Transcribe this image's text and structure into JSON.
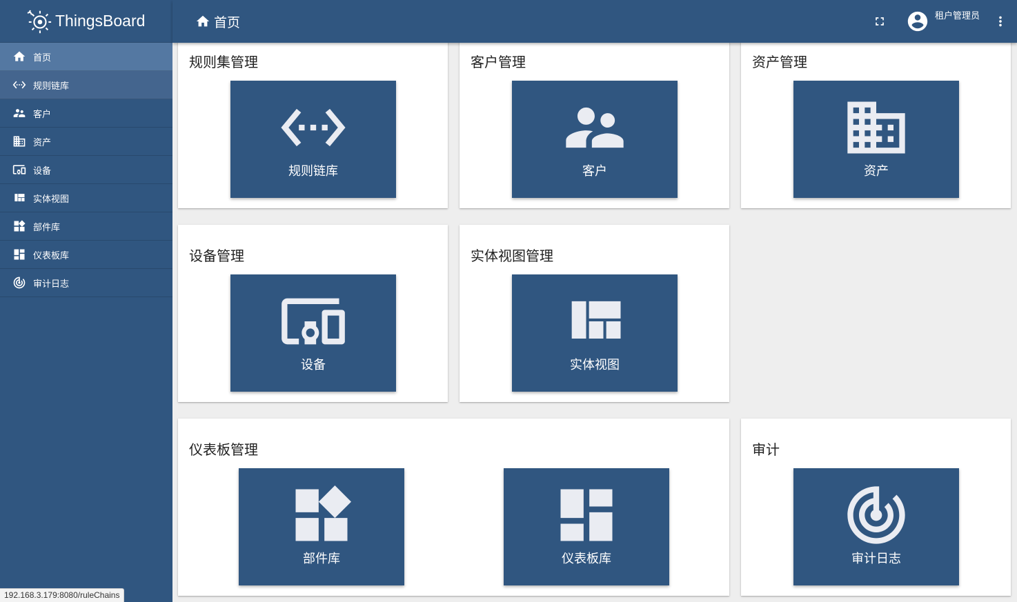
{
  "app": {
    "name": "ThingsBoard"
  },
  "header": {
    "breadcrumb": "首页",
    "user_role": "租户管理员"
  },
  "sidebar": {
    "items": [
      {
        "label": "首页",
        "icon": "home-icon"
      },
      {
        "label": "规则链库",
        "icon": "settings-ethernet-icon"
      },
      {
        "label": "客户",
        "icon": "supervisor-account-icon"
      },
      {
        "label": "资产",
        "icon": "domain-icon"
      },
      {
        "label": "设备",
        "icon": "devices-other-icon"
      },
      {
        "label": "实体视图",
        "icon": "view-quilt-icon"
      },
      {
        "label": "部件库",
        "icon": "widgets-icon"
      },
      {
        "label": "仪表板库",
        "icon": "dashboards-icon"
      },
      {
        "label": "审计日志",
        "icon": "track-changes-icon"
      }
    ]
  },
  "cards": {
    "rule": {
      "title": "规则集管理",
      "tile": "规则链库"
    },
    "customer": {
      "title": "客户管理",
      "tile": "客户"
    },
    "asset": {
      "title": "资产管理",
      "tile": "资产"
    },
    "device": {
      "title": "设备管理",
      "tile": "设备"
    },
    "entity_view": {
      "title": "实体视图管理",
      "tile": "实体视图"
    },
    "dashboard": {
      "title": "仪表板管理",
      "tile_widgets": "部件库",
      "tile_dashboards": "仪表板库"
    },
    "audit": {
      "title": "审计",
      "tile": "审计日志"
    }
  },
  "status_bar": {
    "url": "192.168.3.179:8080/ruleChains"
  },
  "colors": {
    "primary": "#305680",
    "sidebar_active": "#5478a2",
    "background": "#eeeeee",
    "icon_fill": "#eaecf2"
  }
}
